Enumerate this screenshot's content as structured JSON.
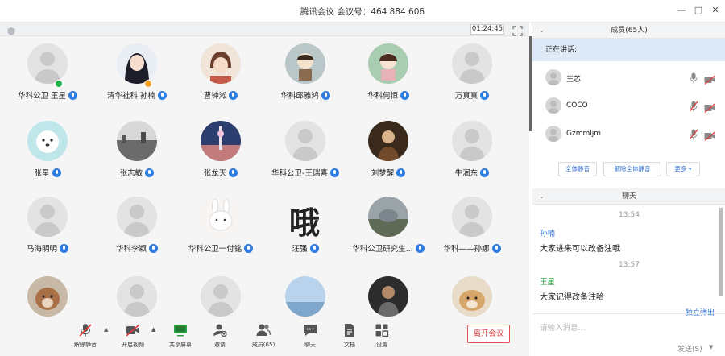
{
  "window": {
    "title": "腾讯会议 会议号：464 884 606",
    "minimize": "—",
    "maximize": "□",
    "close": "✕"
  },
  "subbar": {
    "timer": "01:24:45"
  },
  "participants": [
    {
      "name": "华科公卫 王星",
      "style": "gray",
      "mini": "#22b14c"
    },
    {
      "name": "清华社科 孙楠",
      "style": "anime1",
      "mini": "#f0a020"
    },
    {
      "name": "曹钟淞",
      "style": "anime2",
      "mini": ""
    },
    {
      "name": "华科邱雅鸿",
      "style": "cartoon1",
      "mini": ""
    },
    {
      "name": "华科何恒",
      "style": "cartoon2",
      "mini": ""
    },
    {
      "name": "万真真",
      "style": "gray",
      "mini": ""
    },
    {
      "name": "张星",
      "style": "dog",
      "mini": ""
    },
    {
      "name": "张志敏",
      "style": "city",
      "mini": ""
    },
    {
      "name": "张龙天",
      "style": "tower",
      "mini": ""
    },
    {
      "name": "华科公卫-王瑞喜",
      "style": "gray",
      "mini": ""
    },
    {
      "name": "刘梦醒",
      "style": "dark",
      "mini": ""
    },
    {
      "name": "牛润东",
      "style": "gray",
      "mini": ""
    },
    {
      "name": "马海明明",
      "style": "gray",
      "mini": ""
    },
    {
      "name": "华科李颖",
      "style": "gray",
      "mini": ""
    },
    {
      "name": "华科公卫一付铭",
      "style": "bunny",
      "mini": ""
    },
    {
      "name": "汪强",
      "style": "char",
      "mini": ""
    },
    {
      "name": "华科公卫研究生...",
      "style": "photo",
      "mini": ""
    },
    {
      "name": "华科——孙娜",
      "style": "gray",
      "mini": ""
    },
    {
      "name": "",
      "style": "puppy",
      "mini": ""
    },
    {
      "name": "",
      "style": "gray",
      "mini": ""
    },
    {
      "name": "",
      "style": "gray",
      "mini": ""
    },
    {
      "name": "",
      "style": "sky",
      "mini": ""
    },
    {
      "name": "",
      "style": "dark2",
      "mini": ""
    },
    {
      "name": "",
      "style": "puppy2",
      "mini": ""
    }
  ],
  "char_avatar_text": "哦",
  "toolbar": {
    "unmute": "解除静音",
    "start_video": "开启视频",
    "share_screen": "共享屏幕",
    "invite": "邀请",
    "members": "成员(65)",
    "chat": "聊天",
    "docs": "文档",
    "apps": "设置",
    "end_meeting": "离开会议"
  },
  "members_panel": {
    "header": "成员(65人)",
    "speaking_label": "正在讲话:",
    "members": [
      {
        "name": "王芯"
      },
      {
        "name": "COCO"
      },
      {
        "name": "Gzmmljm"
      }
    ],
    "mute_all": "全体静音",
    "unmute_all": "解除全体静音",
    "more": "更多 ▾"
  },
  "chat_panel": {
    "header": "聊天",
    "messages": [
      {
        "time": "13:54",
        "sender": "孙楠",
        "sender_color": "#2f6fce",
        "text": "大家进来可以改备注哦"
      },
      {
        "time": "13:57",
        "sender": "王星",
        "sender_color": "#2aa140",
        "text": "大家记得改备注哈"
      }
    ],
    "popout": "独立弹出",
    "input_placeholder": "请输入消息...",
    "send": "发送(S)"
  },
  "colors": {
    "accent": "#2f7de1",
    "end_red": "#d43a3a",
    "speaking_bg": "#dde9f6"
  }
}
